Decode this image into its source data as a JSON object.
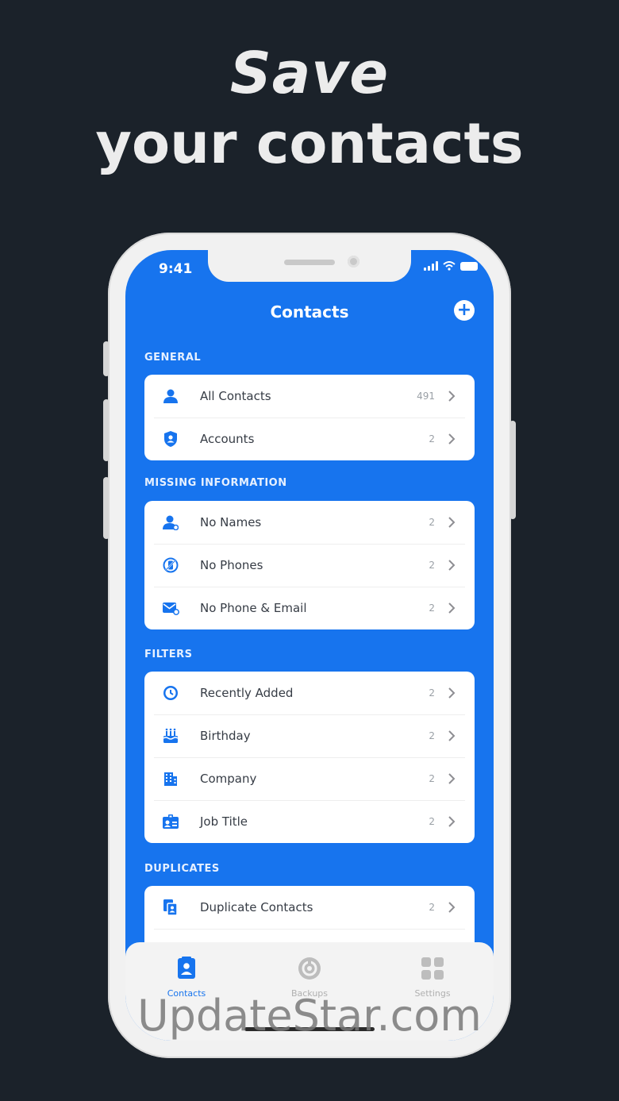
{
  "headline": {
    "line1": "Save",
    "line2": "your contacts"
  },
  "status": {
    "time": "9:41"
  },
  "nav": {
    "title": "Contacts",
    "add_symbol": "+"
  },
  "sections": [
    {
      "label": "GENERAL",
      "rows": [
        {
          "icon": "person-icon",
          "label": "All Contacts",
          "count": "491"
        },
        {
          "icon": "shield-person-icon",
          "label": "Accounts",
          "count": "2"
        }
      ]
    },
    {
      "label": "MISSING INFORMATION",
      "rows": [
        {
          "icon": "person-missing-icon",
          "label": "No Names",
          "count": "2"
        },
        {
          "icon": "phone-off-icon",
          "label": "No Phones",
          "count": "2"
        },
        {
          "icon": "mail-off-icon",
          "label": "No Phone & Email",
          "count": "2"
        }
      ]
    },
    {
      "label": "FILTERS",
      "rows": [
        {
          "icon": "clock-icon",
          "label": "Recently Added",
          "count": "2"
        },
        {
          "icon": "cake-icon",
          "label": "Birthday",
          "count": "2"
        },
        {
          "icon": "building-icon",
          "label": "Company",
          "count": "2"
        },
        {
          "icon": "badge-icon",
          "label": "Job Title",
          "count": "2"
        }
      ]
    },
    {
      "label": "DUPLICATES",
      "rows": [
        {
          "icon": "duplicate-icon",
          "label": "Duplicate Contacts",
          "count": "2"
        }
      ]
    }
  ],
  "tabs": [
    {
      "label": "Contacts",
      "icon": "contacts-book-icon",
      "active": true
    },
    {
      "label": "Backups",
      "icon": "backup-icon",
      "active": false
    },
    {
      "label": "Settings",
      "icon": "grid-icon",
      "active": false
    }
  ],
  "watermark": "UpdateStar.com",
  "colors": {
    "background": "#1b222a",
    "accent": "#1774ee",
    "card": "#ffffff",
    "phone_frame": "#f1f1f1"
  }
}
